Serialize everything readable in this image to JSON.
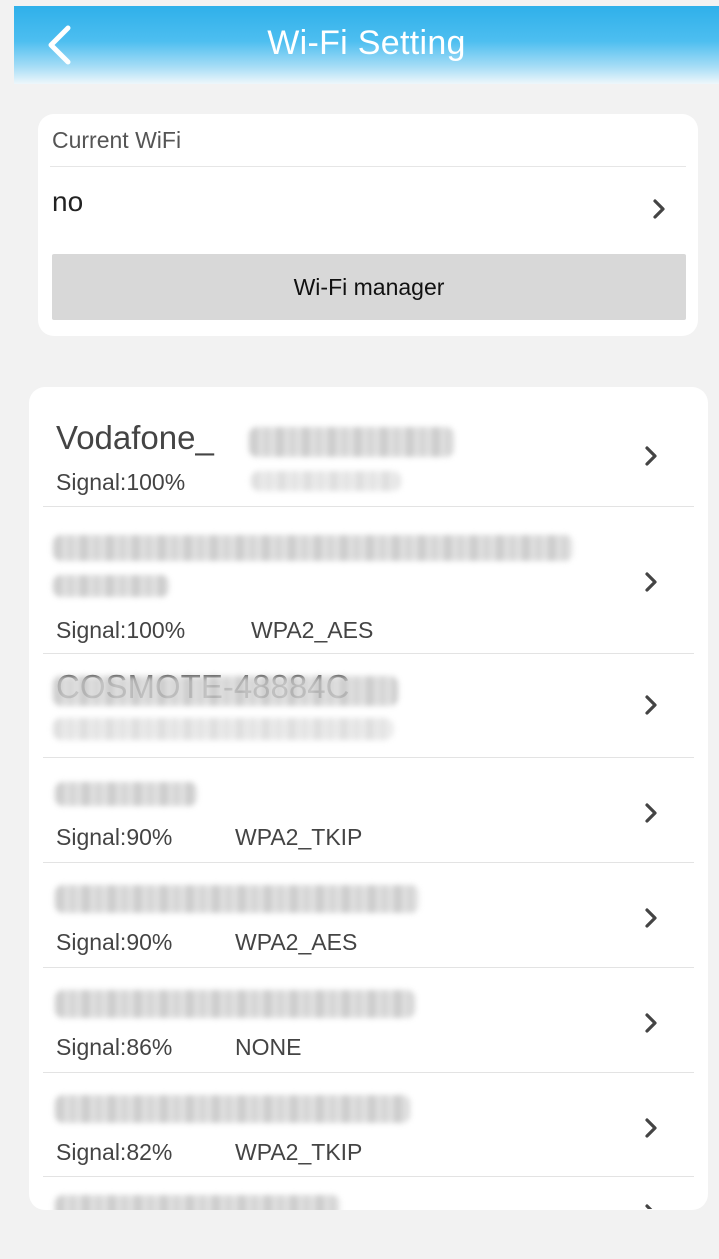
{
  "header": {
    "title": "Wi-Fi Setting",
    "back_icon": "chevron-left-icon"
  },
  "current": {
    "label": "Current WiFi",
    "value": "no",
    "manager_label": "Wi-Fi manager"
  },
  "networks": [
    {
      "name": "Vodafone_",
      "signal": "Signal:100%",
      "security": ""
    },
    {
      "name": "",
      "signal": "Signal:100%",
      "security": "WPA2_AES"
    },
    {
      "name": "COSMOTE-48884C",
      "signal": "",
      "security": ""
    },
    {
      "name": "",
      "signal": "Signal:90%",
      "security": "WPA2_TKIP"
    },
    {
      "name": "",
      "signal": "Signal:90%",
      "security": "WPA2_AES"
    },
    {
      "name": "",
      "signal": "Signal:86%",
      "security": "NONE"
    },
    {
      "name": "",
      "signal": "Signal:82%",
      "security": "WPA2_TKIP"
    },
    {
      "name": "",
      "signal": "",
      "security": ""
    }
  ],
  "colors": {
    "header_accent": "#2fb0ea",
    "background": "#f2f2f2",
    "button_gray": "#d8d8d8"
  }
}
